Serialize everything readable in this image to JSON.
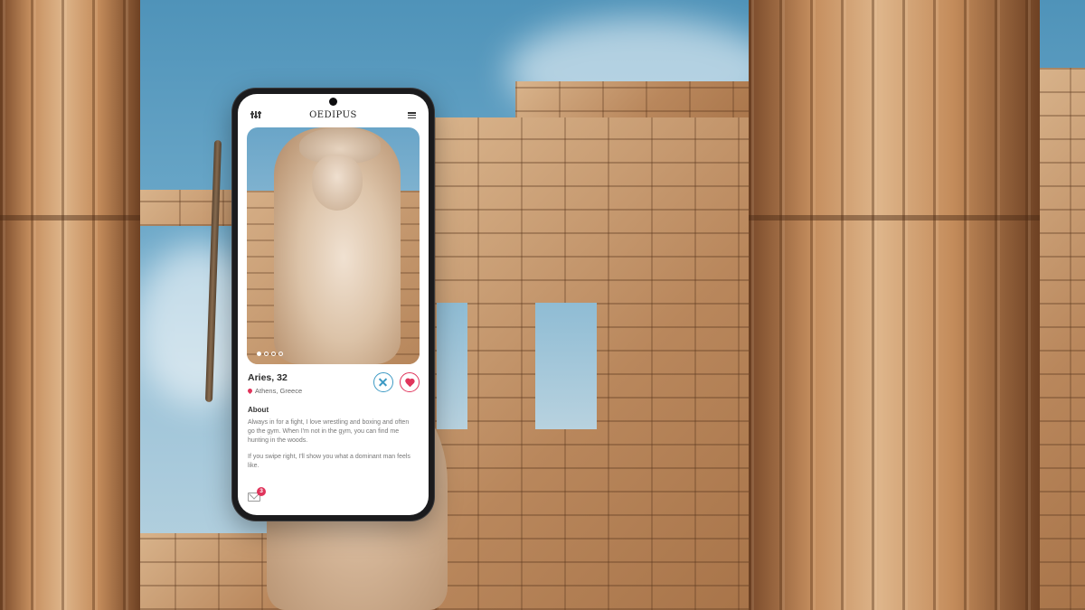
{
  "app": {
    "logo": "OEDIPUS"
  },
  "profile": {
    "name_age": "Aries, 32",
    "location": "Athens, Greece",
    "photo_count": 4,
    "active_photo_index": 0
  },
  "about": {
    "title": "About",
    "paragraph_1": "Always in for a fight, I love wrestling and boxing and often go the gym. When I'm not in the gym, you can find me hunting in the woods.",
    "paragraph_2": "If you swipe right, I'll show you what a dominant man feels like."
  },
  "messages": {
    "unread_count": "3"
  },
  "icons": {
    "filter": "sliders-icon",
    "menu": "hamburger-menu-icon",
    "location": "map-pin-icon",
    "dislike": "close-circle-icon",
    "like": "heart-circle-icon",
    "messages": "envelope-icon"
  },
  "colors": {
    "like": "#e0345b",
    "dislike": "#3d9ac4",
    "badge": "#e0345b"
  }
}
